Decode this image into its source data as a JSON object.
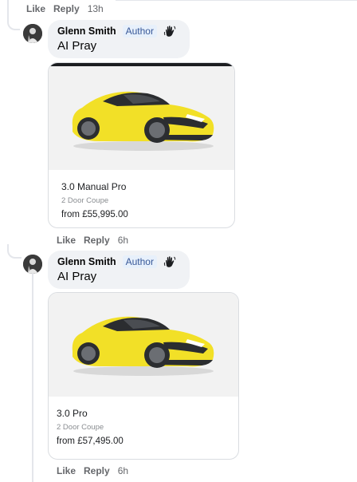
{
  "top_actions": {
    "like": "Like",
    "reply": "Reply",
    "time": "13h"
  },
  "comments": [
    {
      "author": "Glenn Smith",
      "badge": "Author",
      "text": "AI Pray",
      "card": {
        "model": "3.0 Manual Pro",
        "body_type": "2 Door Coupe",
        "price": "from £55,995.00",
        "car_color": "#f2e027"
      },
      "actions": {
        "like": "Like",
        "reply": "Reply",
        "time": "6h"
      }
    },
    {
      "author": "Glenn Smith",
      "badge": "Author",
      "text": "AI Pray",
      "card": {
        "model": "3.0 Pro",
        "body_type": "2 Door Coupe",
        "price": "from £57,495.00",
        "car_color": "#f2e027"
      },
      "actions": {
        "like": "Like",
        "reply": "Reply",
        "time": "6h"
      }
    }
  ]
}
